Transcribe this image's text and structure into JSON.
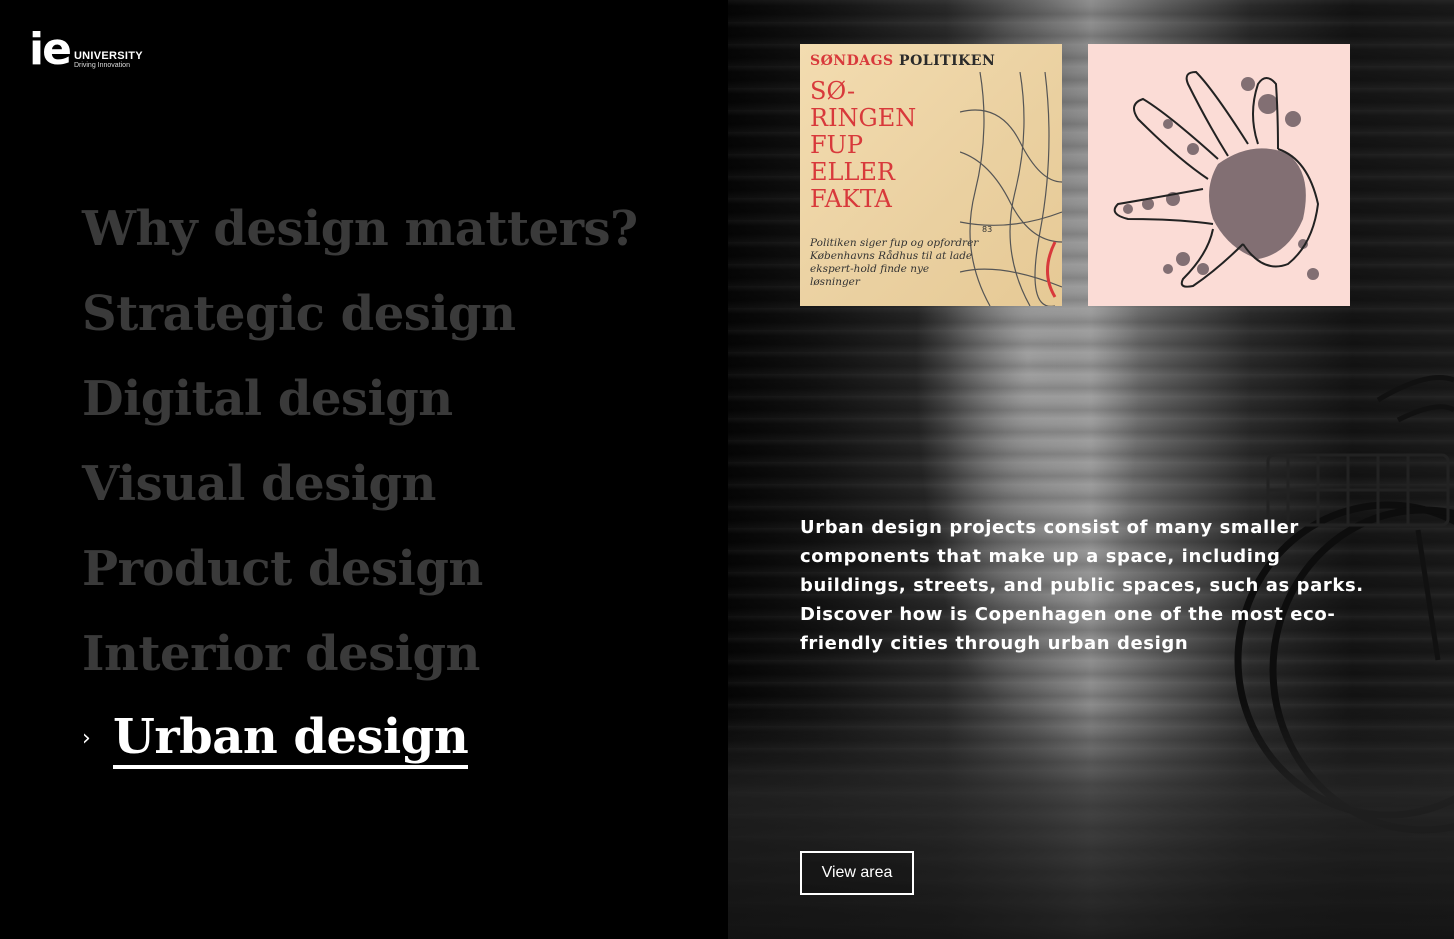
{
  "brand": {
    "logo_mark": "ie",
    "name": "UNIVERSITY",
    "tagline": "Driving Innovation"
  },
  "menu": {
    "items": [
      {
        "label": "Why design matters?",
        "active": false
      },
      {
        "label": "Strategic design",
        "active": false
      },
      {
        "label": "Digital design",
        "active": false
      },
      {
        "label": "Visual design",
        "active": false
      },
      {
        "label": "Product design",
        "active": false
      },
      {
        "label": "Interior design",
        "active": false
      },
      {
        "label": "Urban design",
        "active": true
      }
    ],
    "active_chevron": "›"
  },
  "thumbnails": {
    "newspaper": {
      "masthead_left": "SØNDAGS",
      "masthead_right": "POLITIKEN",
      "headline": [
        "SØ-",
        "RINGEN",
        "FUP",
        "ELLER",
        "FAKTA"
      ],
      "subtext": "Politiken siger fup og opfordrer Københavns Rådhus til at lade ekspert-hold finde nye løsninger",
      "map_label": "83"
    },
    "finger_plan_icon": "copenhagen-finger-plan-map"
  },
  "description": {
    "paragraph_1": "Urban design projects consist of many smaller components that make up a space, including buildings, streets, and public spaces, such as parks.",
    "paragraph_2": "Discover how is Copenhagen one of the most eco-friendly cities through urban design"
  },
  "cta": {
    "label": "View area"
  },
  "colors": {
    "background": "#000000",
    "inactive_menu": "#3a3a3a",
    "active_menu": "#ffffff",
    "newspaper_red": "#d8393b",
    "map_pink": "#fbdcd6"
  }
}
